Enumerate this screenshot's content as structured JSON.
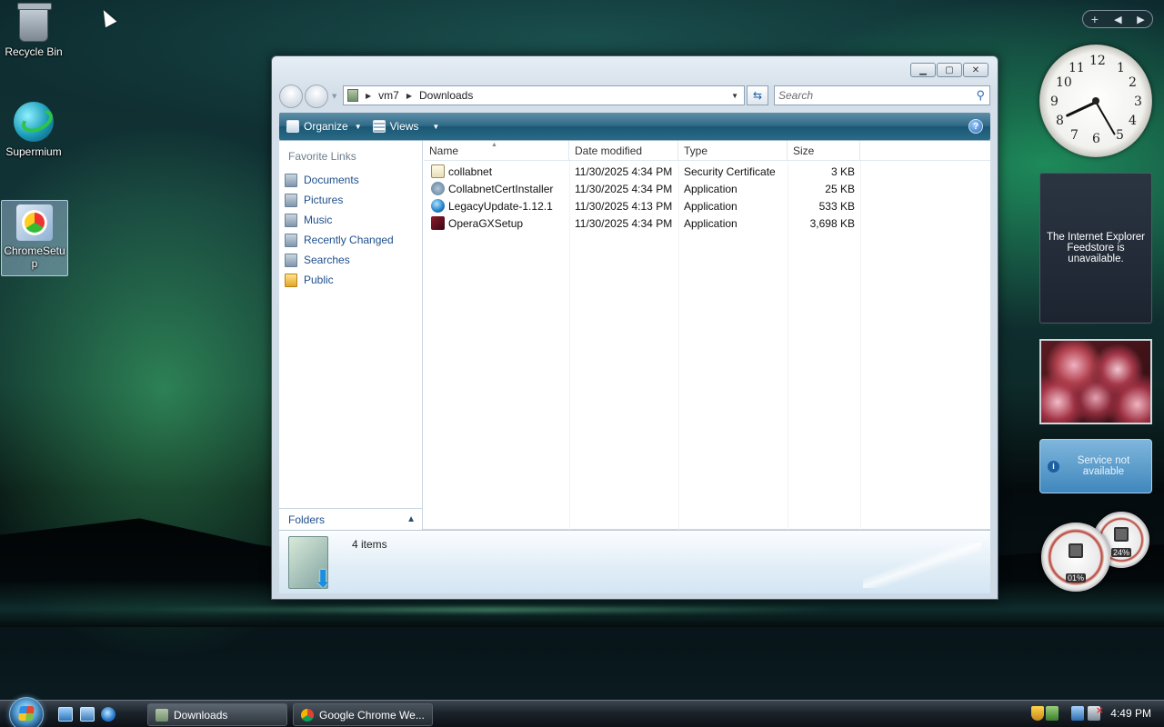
{
  "desktop": {
    "icons": [
      {
        "label": "Recycle Bin",
        "icon": "recycle-bin-icon"
      },
      {
        "label": "Supermium",
        "icon": "supermium-icon"
      },
      {
        "label": "ChromeSetup",
        "icon": "setup-icon"
      }
    ]
  },
  "window": {
    "address": {
      "path": [
        "vm7",
        "Downloads"
      ]
    },
    "search_placeholder": "Search",
    "toolbar": {
      "organize": "Organize",
      "views": "Views"
    },
    "nav_pane": {
      "heading": "Favorite Links",
      "links": [
        "Documents",
        "Pictures",
        "Music",
        "Recently Changed",
        "Searches",
        "Public"
      ],
      "folders": "Folders"
    },
    "columns": {
      "name": "Name",
      "date": "Date modified",
      "type": "Type",
      "size": "Size"
    },
    "files": [
      {
        "name": "collabnet",
        "date": "11/30/2025 4:34 PM",
        "type": "Security Certificate",
        "size": "3 KB",
        "icon": "certificate-icon"
      },
      {
        "name": "CollabnetCertInstaller",
        "date": "11/30/2025 4:34 PM",
        "type": "Application",
        "size": "25 KB",
        "icon": "installer-icon"
      },
      {
        "name": "LegacyUpdate-1.12.1",
        "date": "11/30/2025 4:13 PM",
        "type": "Application",
        "size": "533 KB",
        "icon": "legacy-update-icon"
      },
      {
        "name": "OperaGXSetup",
        "date": "11/30/2025 4:34 PM",
        "type": "Application",
        "size": "3,698 KB",
        "icon": "opera-gx-icon"
      }
    ],
    "details": {
      "count": "4 items"
    }
  },
  "gadgets": {
    "clock_numbers": [
      "12",
      "1",
      "2",
      "3",
      "4",
      "5",
      "6",
      "7",
      "8",
      "9",
      "10",
      "11"
    ],
    "feed_message": "The Internet Explorer Feedstore is unavailable.",
    "service_message": "Service not available",
    "cpu": "01%",
    "memory": "24%"
  },
  "taskbar": {
    "buttons": [
      "Downloads",
      "Google Chrome We..."
    ],
    "time": "4:49 PM"
  },
  "colors": {
    "toolbar": "#2f6a86",
    "link": "#1e4f8c"
  }
}
